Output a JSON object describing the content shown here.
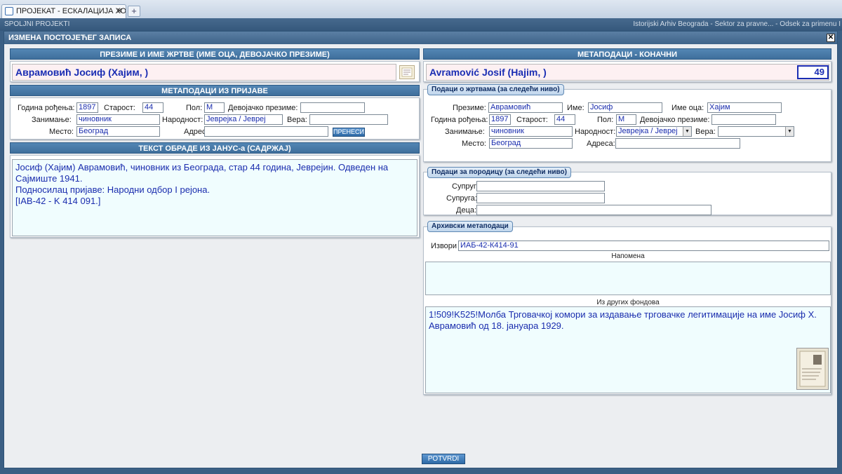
{
  "browser": {
    "tab_title": "ПРОЈЕКАТ - ЕСКАЛАЦИЈА ХОЛОКА...",
    "tab_close": "✕",
    "new_tab": "+"
  },
  "appbar": {
    "title": "SPOLJNI PROJEKTI",
    "archive": "Istorijski Arhiv Beograda - Sektor za pravne... - Odsek za primenu I"
  },
  "modal": {
    "title": "ИЗМЕНА ПОСТОЈЕЋЕГ ЗАПИСА",
    "close": "✕",
    "confirm_label": "POTVRDI"
  },
  "left": {
    "name_header": "ПРЕЗИМЕ И ИМЕ ЖРТВЕ (ИМЕ ОЦА, ДЕВОЈАЧКО ПРЕЗИМЕ)",
    "name_value": "Аврамовић Јосиф (Хајим, )",
    "meta_header": "МЕТАПОДАЦИ ИЗ ПРИЈАВЕ",
    "birth_label": "Година рођења:",
    "birth_value": "1897",
    "age_label": "Старост:",
    "age_value": "44",
    "sex_label": "Пол:",
    "sex_value": "М",
    "maiden_label": "Девојачко презиме:",
    "maiden_value": "",
    "occupation_label": "Занимање:",
    "occupation_value": "чиновник",
    "nationality_label": "Народност:",
    "nationality_value": "Јеврејка / Јевреј",
    "religion_label": "Вера:",
    "religion_value": "",
    "place_label": "Место:",
    "place_value": "Београд",
    "address_label": "Адреса:",
    "address_value": "",
    "transfer_button": "ПРЕНЕСИ",
    "janus_header": "ТЕКСТ ОБРАДЕ ИЗ ЈАНУС-а (САДРЖАЈ)",
    "janus_line1": "Јосиф (Хајим) Аврамовић, чиновник из Београда, стар 44 година, Јеврејин. Одведен на",
    "janus_line2": "Сајмиште 1941.",
    "janus_line3": "Подносилац пријаве: Народни одбор I рејона.",
    "janus_line4": "[IAB-42 - K 414 091.]"
  },
  "right": {
    "meta_header": "МЕТАПОДАЦИ - КОНАЧНИ",
    "name_value": "Avramović Josif (Hajim, )",
    "record_number": "49",
    "victim_legend": "Подаци о жртвама (за следећи ниво)",
    "surname_label": "Презиме:",
    "surname_value": "Аврамовић",
    "firstname_label": "Име:",
    "firstname_value": "Јосиф",
    "father_label": "Име оца:",
    "father_value": "Хајим",
    "birth_label": "Година рођења:",
    "birth_value": "1897",
    "age_label": "Старост:",
    "age_value": "44",
    "sex_label": "Пол:",
    "sex_value": "М",
    "maiden_label": "Девојачко презиме:",
    "maiden_value": "",
    "occupation_label": "Занимање:",
    "occupation_value": "чиновник",
    "nationality_label": "Народност:",
    "nationality_value": "Јеврејка / Јевреј",
    "religion_label": "Вера:",
    "religion_value": "",
    "place_label": "Место:",
    "place_value": "Београд",
    "address_label": "Адреса:",
    "address_value": "",
    "family_legend": "Подаци за породицу (за следећи ниво)",
    "husband_label": "Супруг:",
    "husband_value": "",
    "wife_label": "Супруга:",
    "wife_value": "",
    "children_label": "Деца:",
    "children_value": "",
    "archive_legend": "Архивски метаподаци",
    "sources_label": "Извори",
    "sources_value": "ИАБ-42-К414-91",
    "note_label": "Напомена",
    "note_value": "",
    "other_label": "Из других фондова",
    "other_line1": "1!509!K525!Молба Трговачкој комори за издавање трговачке легитимације на име Јосиф Х.",
    "other_line2": "Аврамовић од 18. јануара 1929."
  },
  "colors": {
    "header_blue": "#3f6f9c",
    "text_blue": "#1a2dae",
    "name_bg": "#fdf0f2",
    "textarea_bg": "#f0fdfe"
  }
}
